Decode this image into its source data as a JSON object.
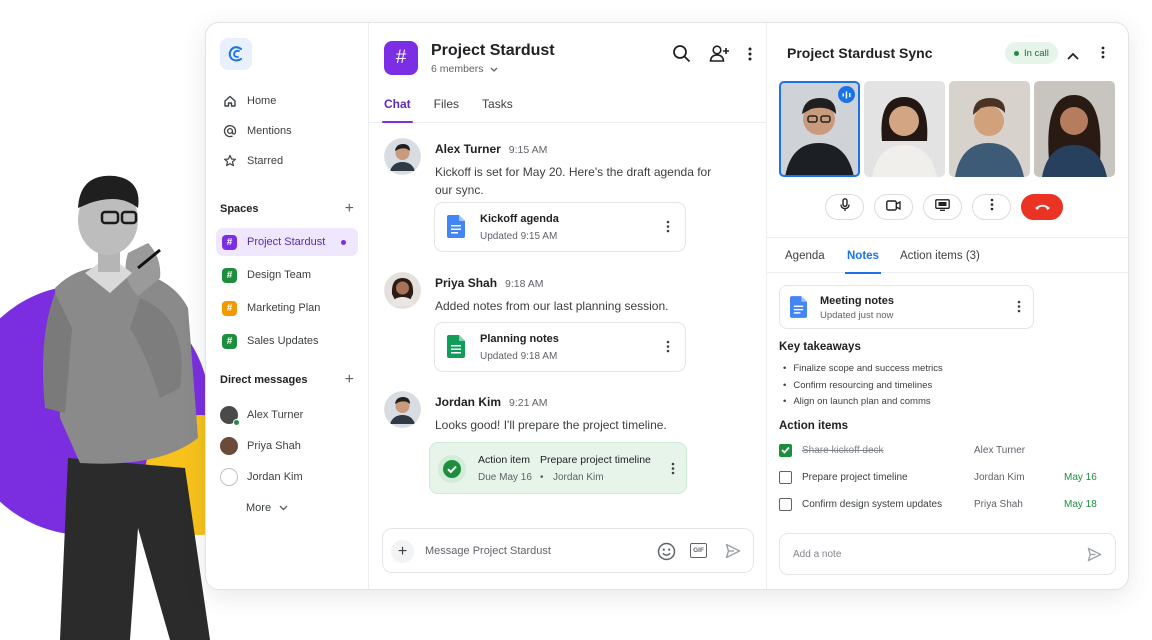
{
  "sidebar": {
    "nav": [
      {
        "label": "Home",
        "icon": "home-icon"
      },
      {
        "label": "Mentions",
        "icon": "at-icon"
      },
      {
        "label": "Starred",
        "icon": "star-icon"
      }
    ],
    "spaces_title": "Spaces",
    "spaces": [
      {
        "label": "Project Stardust",
        "color": "#7b2ee3",
        "active": true
      },
      {
        "label": "Design Team",
        "color": "#1e8e3e"
      },
      {
        "label": "Marketing Plan",
        "color": "#f29900"
      },
      {
        "label": "Sales Updates",
        "color": "#1e8e3e"
      }
    ],
    "dm_title": "Direct messages",
    "dms": [
      {
        "label": "Alex Turner",
        "online": true
      },
      {
        "label": "Priya Shah"
      },
      {
        "label": "Jordan Kim"
      }
    ],
    "more_label": "More"
  },
  "chat": {
    "title": "Project Stardust",
    "members": "6 members",
    "tabs": [
      "Chat",
      "Files",
      "Tasks"
    ],
    "messages": [
      {
        "author": "Alex Turner",
        "time": "9:15 AM",
        "text": "Kickoff is set for May 20. Here's the draft agenda for our sync.",
        "attachment": {
          "title": "Kickoff agenda",
          "subtitle": "Updated 9:15 AM",
          "icon": "docs-icon"
        }
      },
      {
        "author": "Priya Shah",
        "time": "9:18 AM",
        "text": "Added notes from our last planning session.",
        "attachment": {
          "title": "Planning notes",
          "subtitle": "Updated 9:18 AM",
          "icon": "sheets-icon"
        }
      },
      {
        "author": "Jordan Kim",
        "time": "9:21 AM",
        "text": "Looks good! I'll prepare the project timeline."
      }
    ],
    "action_item": {
      "label": "Action item",
      "task": "Prepare project timeline",
      "due": "Due May 16",
      "separator": "•",
      "owner": "Jordan Kim"
    },
    "composer_placeholder": "Message Project Stardust",
    "gif_label": "GIF"
  },
  "meeting": {
    "title": "Project Stardust Sync",
    "status": "In call",
    "tabs": [
      "Agenda",
      "Notes",
      "Action items (3)"
    ],
    "notes_doc": {
      "title": "Meeting notes",
      "subtitle": "Updated just now"
    },
    "takeaways_title": "Key takeaways",
    "takeaways": [
      "Finalize scope and success metrics",
      "Confirm resourcing and timelines",
      "Align on launch plan and comms"
    ],
    "actions_title": "Action items",
    "actions": [
      {
        "task": "Share kickoff deck",
        "owner": "Alex Turner",
        "due": "",
        "done": true
      },
      {
        "task": "Prepare project timeline",
        "owner": "Jordan Kim",
        "due": "May 16",
        "done": false
      },
      {
        "task": "Confirm design system updates",
        "owner": "Priya Shah",
        "due": "May 18",
        "done": false
      }
    ],
    "note_placeholder": "Add a note"
  },
  "colors": {
    "accent": "#7b2ee3",
    "blue": "#1a73e8",
    "green": "#1e8e3e",
    "end_call": "#ea3323"
  }
}
